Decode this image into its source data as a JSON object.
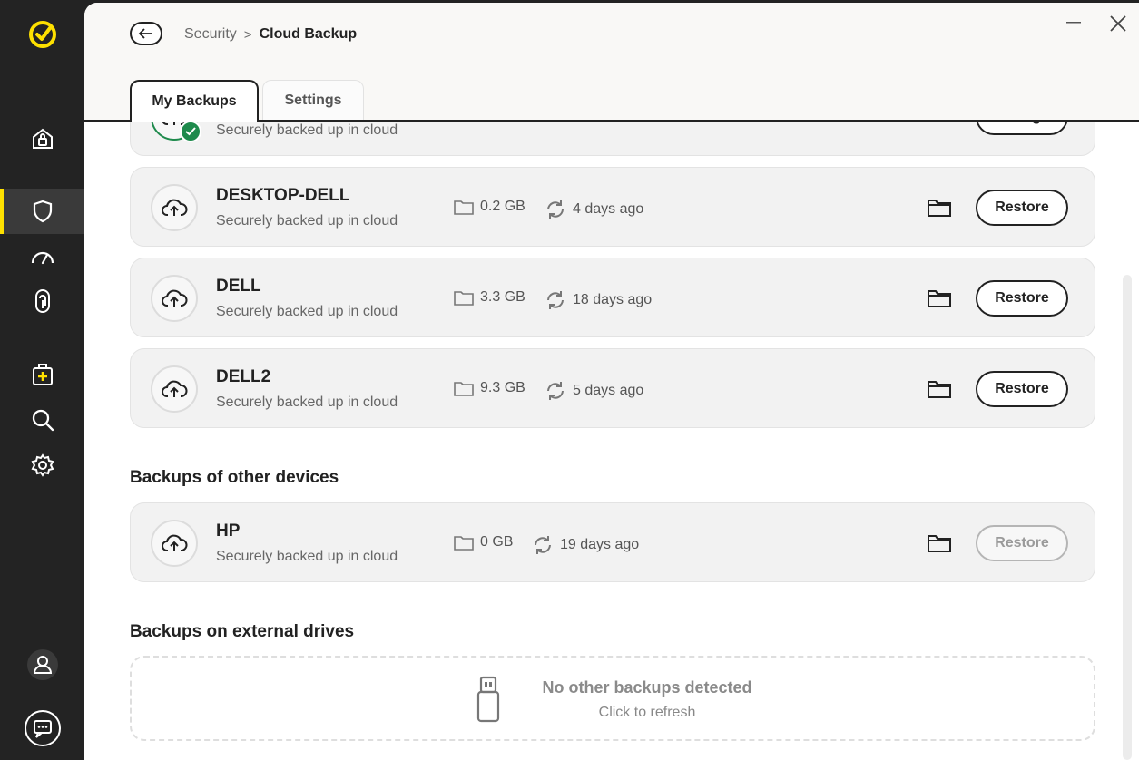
{
  "app": {
    "accent": "#fee000",
    "success": "#1e8a4c"
  },
  "header": {
    "breadcrumb_parent": "Security",
    "breadcrumb_separator": ">",
    "breadcrumb_current": "Cloud Backup"
  },
  "tabs": [
    {
      "label": "My Backups",
      "active": true
    },
    {
      "label": "Settings",
      "active": false
    }
  ],
  "my_backups": [
    {
      "name": "",
      "status": "Securely backed up in cloud",
      "size": "",
      "time": "",
      "action": "Manage"
    },
    {
      "name": "DESKTOP-DELL",
      "status": "Securely backed up in cloud",
      "size": "0.2 GB",
      "time": "4 days ago",
      "action": "Restore"
    },
    {
      "name": "DELL",
      "status": "Securely backed up in cloud",
      "size": "3.3 GB",
      "time": "18 days ago",
      "action": "Restore"
    },
    {
      "name": "DELL2",
      "status": "Securely backed up in cloud",
      "size": "9.3 GB",
      "time": "5 days ago",
      "action": "Restore"
    }
  ],
  "other_devices": {
    "title": "Backups of other devices",
    "items": [
      {
        "name": "HP",
        "status": "Securely backed up in cloud",
        "size": "0 GB",
        "time": "19 days ago",
        "action": "Restore"
      }
    ]
  },
  "external": {
    "title": "Backups on external drives",
    "empty_title": "No other backups detected",
    "empty_sub": "Click to refresh"
  },
  "icons": {
    "rail": [
      "norton-logo-icon",
      "home-security-icon",
      "shield-icon",
      "speedometer-icon",
      "fingerprint-icon",
      "medical-kit-icon",
      "search-icon",
      "gear-icon",
      "account-icon",
      "chat-support-icon"
    ]
  }
}
